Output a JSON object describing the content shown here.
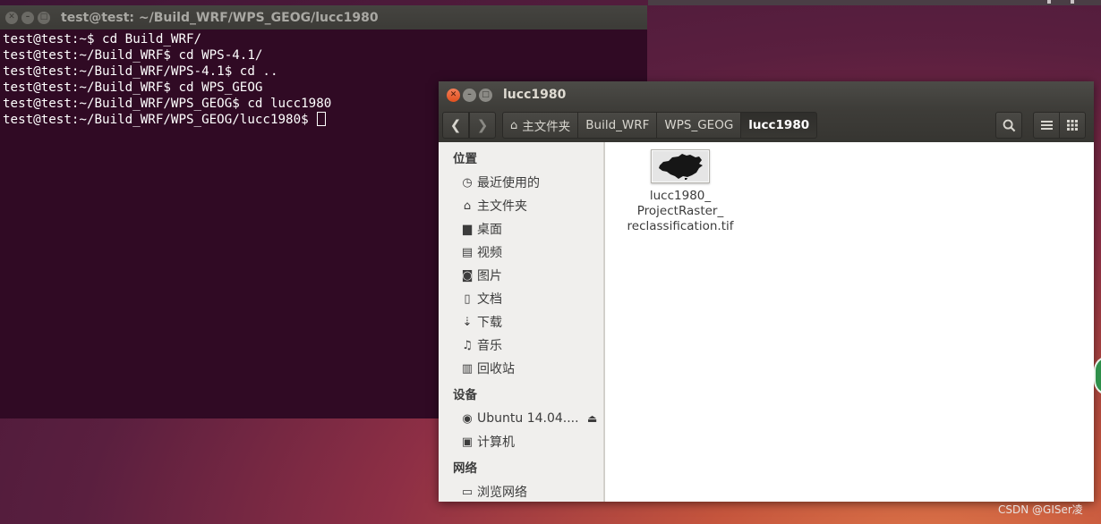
{
  "terminal": {
    "title": "test@test: ~/Build_WRF/WPS_GEOG/lucc1980",
    "lines": [
      "test@test:~$ cd Build_WRF/",
      "test@test:~/Build_WRF$ cd WPS-4.1/",
      "test@test:~/Build_WRF/WPS-4.1$ cd ..",
      "test@test:~/Build_WRF$ cd WPS_GEOG",
      "test@test:~/Build_WRF/WPS_GEOG$ cd lucc1980",
      "test@test:~/Build_WRF/WPS_GEOG/lucc1980$ "
    ],
    "bg_color": "#300a24"
  },
  "file_manager": {
    "title": "lucc1980",
    "breadcrumbs": [
      "主文件夹",
      "Build_WRF",
      "WPS_GEOG",
      "lucc1980"
    ],
    "sidebar": {
      "places_heading": "位置",
      "places": [
        {
          "label": "最近使用的",
          "icon": "clock-icon"
        },
        {
          "label": "主文件夹",
          "icon": "home-icon"
        },
        {
          "label": "桌面",
          "icon": "folder-icon"
        },
        {
          "label": "视频",
          "icon": "film-icon"
        },
        {
          "label": "图片",
          "icon": "camera-icon"
        },
        {
          "label": "文档",
          "icon": "document-icon"
        },
        {
          "label": "下载",
          "icon": "download-icon"
        },
        {
          "label": "音乐",
          "icon": "music-icon"
        },
        {
          "label": "回收站",
          "icon": "trash-icon"
        }
      ],
      "devices_heading": "设备",
      "devices": [
        {
          "label": "Ubuntu 14.04....",
          "icon": "disc-icon"
        },
        {
          "label": "计算机",
          "icon": "computer-icon"
        }
      ],
      "network_heading": "网络",
      "network": [
        {
          "label": "浏览网络",
          "icon": "network-icon"
        }
      ]
    },
    "files": [
      {
        "name_lines": [
          "lucc1980_",
          "ProjectRaster_",
          "reclassification.tif"
        ],
        "icon": "map-thumbnail-icon"
      }
    ],
    "accent_color": "#e2501e"
  },
  "watermark": "CSDN @GISer凌"
}
